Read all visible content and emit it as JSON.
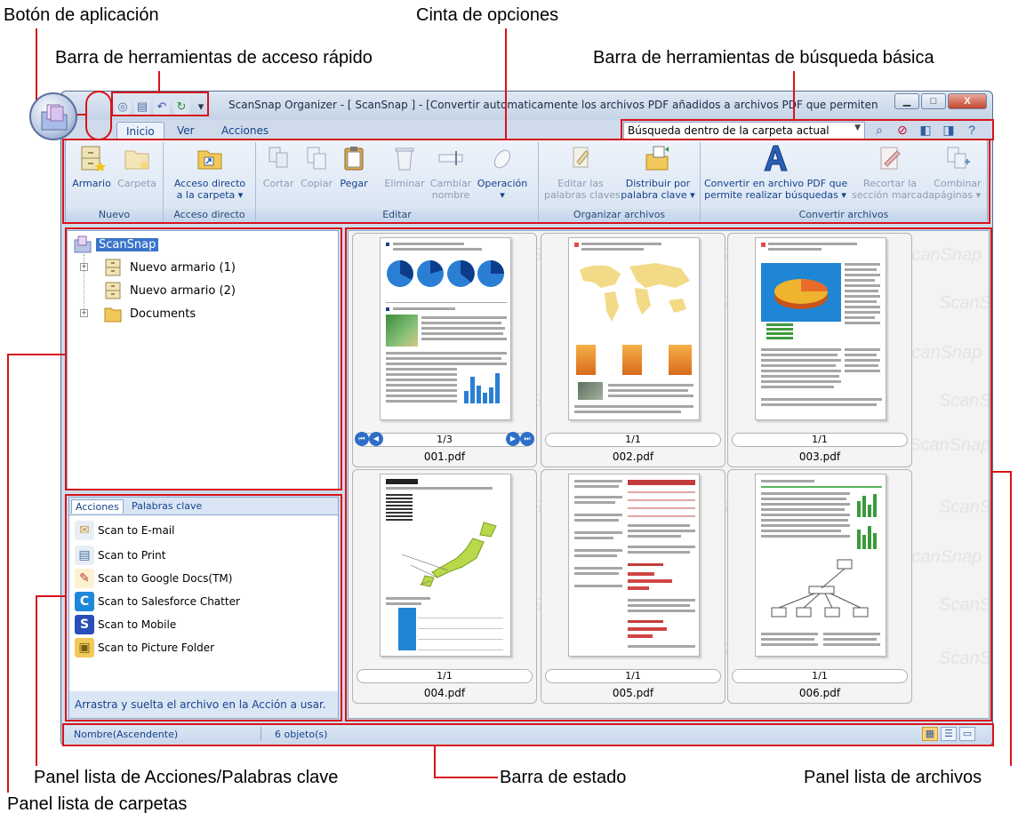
{
  "callouts": {
    "app_button": "Botón de aplicación",
    "ribbon": "Cinta de opciones",
    "qat": "Barra de herramientas de acceso rápido",
    "basic_search": "Barra de herramientas de búsqueda básica",
    "actions_panel": "Panel lista de Acciones/Palabras clave",
    "status_bar": "Barra de estado",
    "file_panel": "Panel lista de archivos",
    "folder_panel": "Panel lista de carpetas"
  },
  "window": {
    "title": "ScanSnap Organizer - [ ScanSnap ] - [Convertir automaticamente los archivos PDF añadidos a archivos PDF que permiten realizar b..."
  },
  "tabs": [
    "Inicio",
    "Ver",
    "Acciones"
  ],
  "search": {
    "value": "Búsqueda dentro de la carpeta actual"
  },
  "ribbon": {
    "nuevo": {
      "label": "Nuevo",
      "armario": "Armario",
      "carpeta": "Carpeta"
    },
    "acceso": {
      "label": "Acceso directo",
      "btn1": "Acceso directo",
      "btn2": "a la carpeta ▾"
    },
    "editar": {
      "label": "Editar",
      "cortar": "Cortar",
      "copiar": "Copiar",
      "pegar": "Pegar",
      "eliminar": "Eliminar",
      "cambiar1": "Cambiar",
      "cambiar2": "nombre",
      "operacion": "Operación",
      "operacion2": "▾"
    },
    "organizar": {
      "label": "Organizar archivos",
      "editar1": "Editar las",
      "editar2": "palabras claves",
      "distribuir1": "Distribuir por",
      "distribuir2": "palabra clave ▾"
    },
    "convertir": {
      "label": "Convertir archivos",
      "conv1": "Convertir en archivo PDF que",
      "conv2": "permite realizar búsquedas ▾",
      "recortar1": "Recortar la",
      "recortar2": "sección marcada",
      "combinar1": "Combinar",
      "combinar2": "páginas ▾"
    }
  },
  "folders": {
    "root": "ScanSnap",
    "items": [
      "Nuevo armario (1)",
      "Nuevo armario (2)",
      "Documents"
    ]
  },
  "actions": {
    "tabs": [
      "Acciones",
      "Palabras clave"
    ],
    "items": [
      "Scan to E-mail",
      "Scan to Print",
      "Scan to Google Docs(TM)",
      "Scan to Salesforce Chatter",
      "Scan to Mobile",
      "Scan to Picture Folder"
    ],
    "hint": "Arrastra y suelta el archivo en la Acción a usar."
  },
  "files": [
    {
      "name": "001.pdf",
      "pages": "1/3"
    },
    {
      "name": "002.pdf",
      "pages": "1/1"
    },
    {
      "name": "003.pdf",
      "pages": "1/1"
    },
    {
      "name": "004.pdf",
      "pages": "1/1"
    },
    {
      "name": "005.pdf",
      "pages": "1/1"
    },
    {
      "name": "006.pdf",
      "pages": "1/1"
    }
  ],
  "watermark": "ScanSnap",
  "status": {
    "sort": "Nombre(Ascendente)",
    "count": "6 objeto(s)"
  },
  "colors": {
    "callout_red": "#d7141a",
    "ribbon_text": "#15428b"
  }
}
